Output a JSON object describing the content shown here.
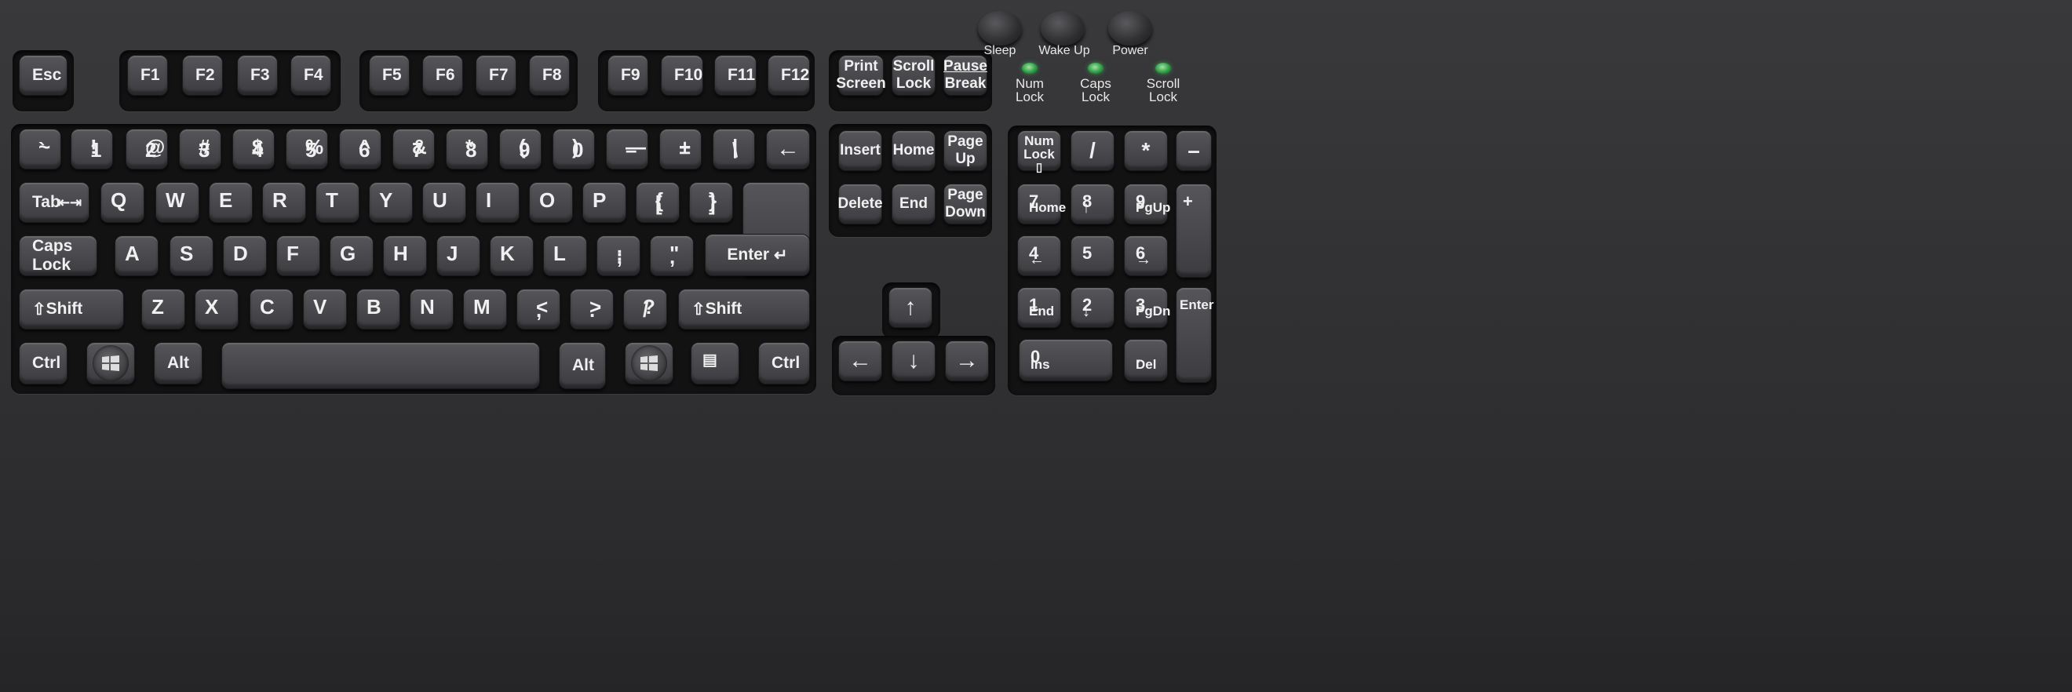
{
  "top_buttons": {
    "sleep": "Sleep",
    "wake_up": "Wake Up",
    "power": "Power"
  },
  "leds": {
    "num_lock": [
      "Num",
      "Lock"
    ],
    "caps_lock": [
      "Caps",
      "Lock"
    ],
    "scroll_lock": [
      "Scroll",
      "Lock"
    ]
  },
  "keys": {
    "esc": "Esc",
    "f1": "F1",
    "f2": "F2",
    "f3": "F3",
    "f4": "F4",
    "f5": "F5",
    "f6": "F6",
    "f7": "F7",
    "f8": "F8",
    "f9": "F9",
    "f10": "F10",
    "f11": "F11",
    "f12": "F12",
    "print_screen": [
      "Print",
      "Screen"
    ],
    "scroll_lock": [
      "Scroll",
      "Lock"
    ],
    "pause_break": [
      "Pause",
      "Break"
    ],
    "num_row": [
      {
        "top": "~",
        "bottom": "`"
      },
      {
        "top": "!",
        "bottom": "1"
      },
      {
        "top": "@",
        "bottom": "2"
      },
      {
        "top": "#",
        "bottom": "3"
      },
      {
        "top": "$",
        "bottom": "4"
      },
      {
        "top": "%",
        "bottom": "5"
      },
      {
        "top": "^",
        "bottom": "6"
      },
      {
        "top": "&",
        "bottom": "7"
      },
      {
        "top": "*",
        "bottom": "8"
      },
      {
        "top": "(",
        "bottom": "9"
      },
      {
        "top": ")",
        "bottom": "0"
      },
      {
        "top": "—",
        "bottom": "–"
      },
      {
        "top": "+",
        "bottom": "="
      },
      {
        "top": "|",
        "bottom": "\\"
      }
    ],
    "backspace": "←",
    "tab": "Tab",
    "q_row": [
      "Q",
      "W",
      "E",
      "R",
      "T",
      "Y",
      "U",
      "I",
      "O",
      "P"
    ],
    "brace_open": {
      "top": "{",
      "bottom": "["
    },
    "brace_close": {
      "top": "}",
      "bottom": "]"
    },
    "caps_lock": "Caps Lock",
    "a_row": [
      "A",
      "S",
      "D",
      "F",
      "G",
      "H",
      "J",
      "K",
      "L"
    ],
    "semicolon": {
      "top": ":",
      "bottom": ";"
    },
    "quote": {
      "top": "\"",
      "bottom": ","
    },
    "enter": "Enter",
    "shift": "Shift",
    "z_row": [
      "Z",
      "X",
      "C",
      "V",
      "B",
      "N",
      "M"
    ],
    "comma": {
      "top": "<",
      "bottom": ","
    },
    "period": {
      "top": ">",
      "bottom": "."
    },
    "slash": {
      "top": "?",
      "bottom": "/"
    },
    "ctrl": "Ctrl",
    "alt": "Alt",
    "insert": "Insert",
    "home": "Home",
    "page_up": [
      "Page",
      "Up"
    ],
    "delete": "Delete",
    "end": "End",
    "page_down": [
      "Page",
      "Down"
    ],
    "arrow_up": "↑",
    "arrow_left": "←",
    "arrow_down": "↓",
    "arrow_right": "→",
    "num_lock": [
      "Num",
      "Lock"
    ],
    "np_slash": "/",
    "np_star": "*",
    "np_minus": "–",
    "np_plus": "+",
    "np_7": {
      "top": "7",
      "bottom": "Home"
    },
    "np_8": {
      "top": "8",
      "bottom": "↑"
    },
    "np_9": {
      "top": "9",
      "bottom": "PgUp"
    },
    "np_4": {
      "top": "4",
      "bottom": "←"
    },
    "np_5": {
      "top": "5",
      "bottom": ""
    },
    "np_6": {
      "top": "6",
      "bottom": "→"
    },
    "np_1": {
      "top": "1",
      "bottom": "End"
    },
    "np_2": {
      "top": "2",
      "bottom": "↓"
    },
    "np_3": {
      "top": "3",
      "bottom": "PgDn"
    },
    "np_0": {
      "top": "0",
      "bottom": "Ins"
    },
    "np_dot": {
      "top": ".",
      "bottom": "Del"
    },
    "np_enter": "Enter"
  }
}
